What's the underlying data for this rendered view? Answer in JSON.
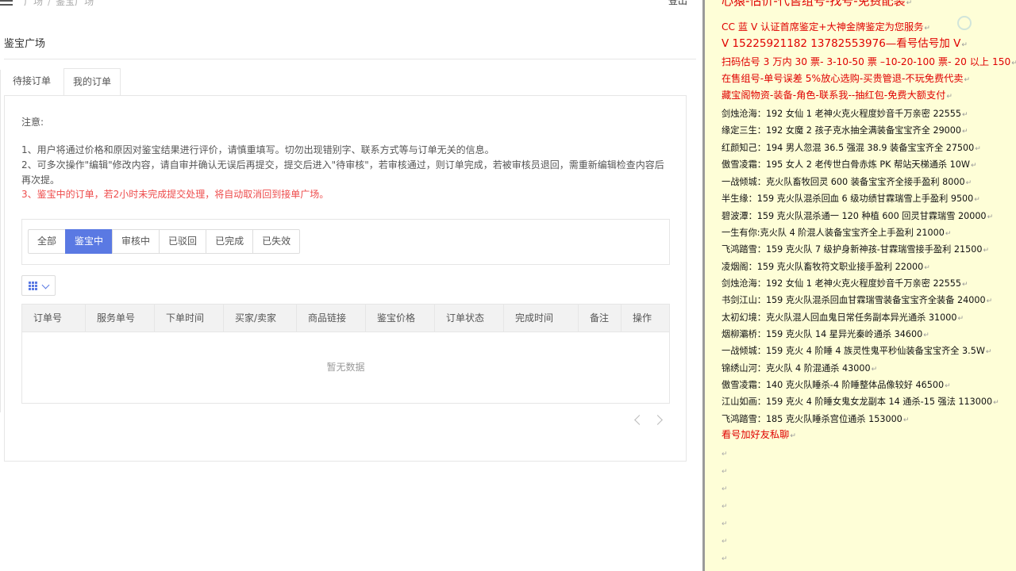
{
  "app": {
    "breadcrumb": [
      "广场",
      "鉴宝广场"
    ],
    "logout_label": "登出",
    "page_title": "鉴宝广场",
    "tabs": [
      {
        "label": "待接订单",
        "active": false
      },
      {
        "label": "我的订单",
        "active": true
      }
    ],
    "notice": {
      "title": "注意:",
      "line1": "1、用户将通过价格和原因对鉴宝结果进行评价，请慎重填写。切勿出现错别字、联系方式等与订单无关的信息。",
      "line2": "2、可多次操作\"编辑\"修改内容，请自审并确认无误后再提交，提交后进入\"待审核\"，若审核通过，则订单完成，若被审核员退回，需重新编辑检查内容后再次提。",
      "line3": "3、鉴宝中的订单，若2小时未完成提交处理，将自动取消回到接单广场。"
    },
    "filters": [
      {
        "label": "全部",
        "active": false
      },
      {
        "label": "鉴宝中",
        "active": true
      },
      {
        "label": "审核中",
        "active": false
      },
      {
        "label": "已驳回",
        "active": false
      },
      {
        "label": "已完成",
        "active": false
      },
      {
        "label": "已失效",
        "active": false
      }
    ],
    "table": {
      "columns": [
        "订单号",
        "服务单号",
        "下单时间",
        "买家/卖家",
        "商品链接",
        "鉴宝价格",
        "订单状态",
        "完成时间",
        "备注",
        "操作"
      ],
      "empty_text": "暂无数据"
    },
    "accent_color": "#5a79e3",
    "warning_color": "#ee4c4c"
  },
  "document": {
    "lines": [
      {
        "text": "心猿-估价-代售组号-找号-免费配装",
        "style": "red-big"
      },
      {
        "text": "CC 蓝 V 认证首席鉴定+大神金牌鉴定为您服务",
        "style": "red"
      },
      {
        "text": "V 15225921182     13782553976—看号估号加 V",
        "style": "red-mid"
      },
      {
        "text": "扫码估号 3 万内 30 票- 3-10-50 票  –10-20-100 票- 20 以上 150",
        "style": "red"
      },
      {
        "text": "在售组号-单号误差 5%放心选购-买贵管退-不玩免费代卖",
        "style": "red"
      },
      {
        "text": "藏宝阁物资-装备-角色-联系我--抽红包-免费大额支付",
        "style": "red"
      },
      {
        "text": "剑烛沧海：192 女仙 1 老神火克火程度妙音千万亲密 22555",
        "style": "normal"
      },
      {
        "text": "缘定三生：192 女魔 2 孩子克水抽全满装备宝宝齐全 29000",
        "style": "normal"
      },
      {
        "text": "红颜知己：194 男人忽混 36.5 强混 38.9 装备宝宝齐全 27500",
        "style": "normal"
      },
      {
        "text": "傲雪凌霜：195 女人 2 老传世白骨赤炼 PK 帮站天梯通杀 10W",
        "style": "normal"
      },
      {
        "text": "一战倾城：克火队畜牧回灵 600 装备宝宝齐全接手盈利 8000",
        "style": "normal"
      },
      {
        "text": "半生缘：159 克火队混杀回血 6 级功绩甘霖瑞雪上手盈利 9500",
        "style": "normal"
      },
      {
        "text": "碧波潭：159 克火队混杀通一 120 种植 600 回灵甘霖瑞雪 20000",
        "style": "normal"
      },
      {
        "text": "一生有你:克火队 4 阶混人装备宝宝齐全上手盈利 21000",
        "style": "normal"
      },
      {
        "text": "飞鸿踏雪：159 克火队 7 级护身新神孩-甘霖瑞雪接手盈利 21500",
        "style": "normal"
      },
      {
        "text": "凌烟阁：159 克火队畜牧符文职业接手盈利 22000",
        "style": "normal"
      },
      {
        "text": "剑烛沧海：192 女仙 1 老神火克火程度妙音千万亲密 22555",
        "style": "normal"
      },
      {
        "text": "书剑江山：159 克火队混杀回血甘霖瑞雪装备宝宝齐全装备 24000",
        "style": "normal"
      },
      {
        "text": "太初幻境：克火队混人回血鬼日常任务副本异光通杀 31000",
        "style": "normal"
      },
      {
        "text": "烟柳灞桥：159 克火队 14 星异光秦岭通杀 34600",
        "style": "normal"
      },
      {
        "text": "一战倾城：159 克火 4 阶睡 4 族灵性鬼平秒仙装备宝宝齐全 3.5W",
        "style": "normal"
      },
      {
        "text": "锦绣山河：克火队 4 阶混通杀 43000",
        "style": "normal"
      },
      {
        "text": "傲雪凌霜：140 克火队睡杀-4 阶睡整体品像较好 46500",
        "style": "normal"
      },
      {
        "text": "江山如画：159 克火 4 阶睡女鬼女龙副本 14 通杀-15 强法 113000",
        "style": "normal"
      },
      {
        "text": "飞鸿踏雪：185 克火队睡杀宫位通杀 153000",
        "style": "normal"
      },
      {
        "text": "看号加好友私聊",
        "style": "red"
      }
    ],
    "background_color": "#fefed7",
    "text_red": "#e00000"
  }
}
